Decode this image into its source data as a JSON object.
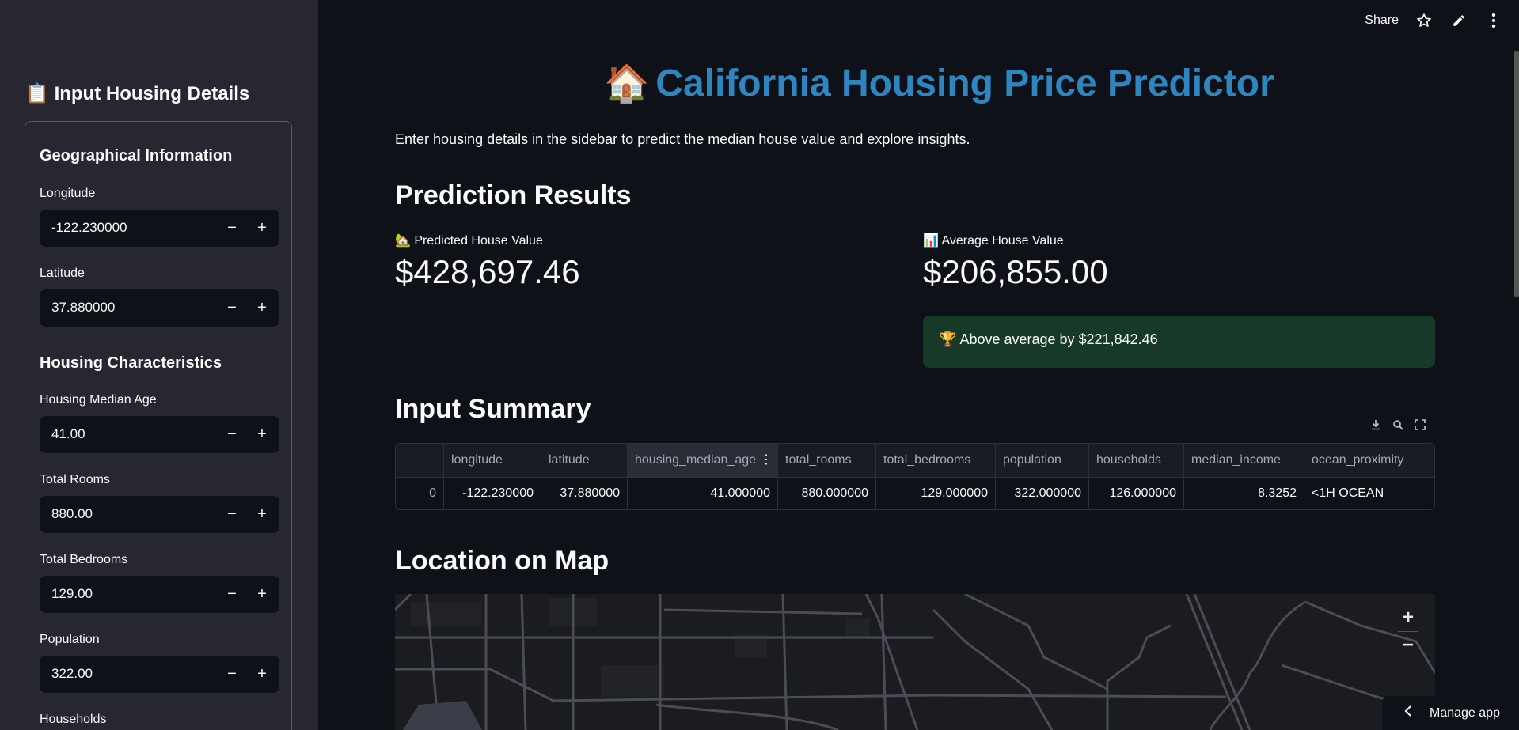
{
  "toolbar": {
    "share": "Share",
    "icons": [
      "star-icon",
      "pencil-icon",
      "more-vertical-icon"
    ]
  },
  "sidebar": {
    "title": "Input Housing Details",
    "title_icon": "clipboard-icon",
    "sections": [
      {
        "heading": "Geographical Information"
      },
      {
        "heading": "Housing Characteristics"
      }
    ],
    "fields": [
      {
        "label": "Longitude",
        "value": "-122.230000"
      },
      {
        "label": "Latitude",
        "value": "37.880000"
      },
      {
        "label": "Housing Median Age",
        "value": "41.00"
      },
      {
        "label": "Total Rooms",
        "value": "880.00"
      },
      {
        "label": "Total Bedrooms",
        "value": "129.00"
      },
      {
        "label": "Population",
        "value": "322.00"
      },
      {
        "label": "Households",
        "value": ""
      }
    ],
    "minus": "−",
    "plus": "+"
  },
  "main": {
    "title": "California Housing Price Predictor",
    "title_icon": "house-emoji",
    "intro": "Enter housing details in the sidebar to predict the median house value and explore insights.",
    "prediction_heading": "Prediction Results",
    "predicted": {
      "label": "Predicted House Value",
      "value": "$428,697.46",
      "icon": "house-garden-emoji"
    },
    "average": {
      "label": "Average House Value",
      "value": "$206,855.00",
      "icon": "bar-chart-emoji"
    },
    "comparison": "Above average by $221,842.46",
    "comparison_icon": "trophy-emoji",
    "summary_heading": "Input Summary",
    "map_heading": "Location on Map",
    "manage_app": "Manage app"
  },
  "table": {
    "columns": [
      "",
      "longitude",
      "latitude",
      "housing_median_age",
      "total_rooms",
      "total_bedrooms",
      "population",
      "households",
      "median_income",
      "ocean_proximity"
    ],
    "rows": [
      [
        "0",
        "-122.230000",
        "37.880000",
        "41.000000",
        "880.000000",
        "129.000000",
        "322.000000",
        "126.000000",
        "8.3252",
        "<1H OCEAN"
      ]
    ]
  },
  "colors": {
    "accent": "#2e86c1",
    "success_bg": "#173928",
    "sidebar_bg": "#262730",
    "page_bg": "#0e1117"
  }
}
